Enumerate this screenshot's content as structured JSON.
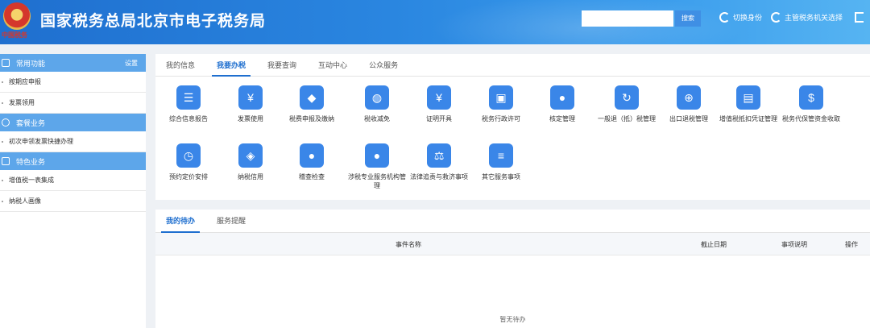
{
  "header": {
    "title": "国家税务总局北京市电子税务局",
    "emblem_text": "中国税务",
    "search_placeholder": "",
    "search_button": "搜索",
    "switch_identity": "切换身份",
    "switch_authority": "主管税务机关选择",
    "colors": {
      "bar_start": "#1f6fcf",
      "bar_end": "#56b4f2"
    }
  },
  "sidebar": {
    "common": {
      "label": "常用功能",
      "setting": "设置",
      "items": [
        "按期应申报",
        "发票领用"
      ]
    },
    "package": {
      "label": "套餐业务",
      "items": [
        "初次申领发票快捷办理"
      ]
    },
    "special": {
      "label": "特色业务",
      "items": [
        "增值税一表集成",
        "纳税人画像"
      ]
    }
  },
  "main": {
    "tabs": [
      "我的信息",
      "我要办税",
      "我要查询",
      "互动中心",
      "公众服务"
    ],
    "active_tab": "我要办税",
    "tiles": [
      {
        "label": "综合信息报告",
        "icon": "report-icon",
        "color": "#3a86e8"
      },
      {
        "label": "发票使用",
        "icon": "invoice-icon",
        "color": "#3a86e8"
      },
      {
        "label": "税费申报及缴纳",
        "icon": "declare-icon",
        "color": "#3a86e8"
      },
      {
        "label": "税收减免",
        "icon": "tax-relief-icon",
        "color": "#3a86e8"
      },
      {
        "label": "证明开具",
        "icon": "certificate-icon",
        "color": "#3a86e8"
      },
      {
        "label": "税务行政许可",
        "icon": "license-icon",
        "color": "#3a86e8"
      },
      {
        "label": "核定管理",
        "icon": "verify-icon",
        "color": "#3a86e8"
      },
      {
        "label": "一般退（抵）税管理",
        "icon": "refund-icon",
        "color": "#3a86e8"
      },
      {
        "label": "出口退税管理",
        "icon": "export-refund-icon",
        "color": "#3a86e8"
      },
      {
        "label": "增值税抵扣凭证管理",
        "icon": "vat-deduction-icon",
        "color": "#3a86e8"
      },
      {
        "label": "税务代保管资金收取",
        "icon": "custody-fund-icon",
        "color": "#3a86e8"
      },
      {
        "label": "预约定价安排",
        "icon": "pricing-icon",
        "color": "#3a86e8"
      },
      {
        "label": "纳税信用",
        "icon": "credit-icon",
        "color": "#3a86e8"
      },
      {
        "label": "稽查检查",
        "icon": "inspection-icon",
        "color": "#3a86e8"
      },
      {
        "label": "涉税专业服务机构管理",
        "icon": "agency-icon",
        "color": "#3a86e8"
      },
      {
        "label": "法律追责与救济事项",
        "icon": "law-icon",
        "color": "#3a86e8"
      },
      {
        "label": "其它服务事项",
        "icon": "other-services-icon",
        "color": "#3a86e8"
      }
    ]
  },
  "todo": {
    "tabs": [
      "我的待办",
      "服务提醒"
    ],
    "active_tab": "我的待办",
    "columns": [
      "事件名称",
      "截止日期",
      "事项说明",
      "操作"
    ],
    "empty_text": "暂无待办"
  }
}
